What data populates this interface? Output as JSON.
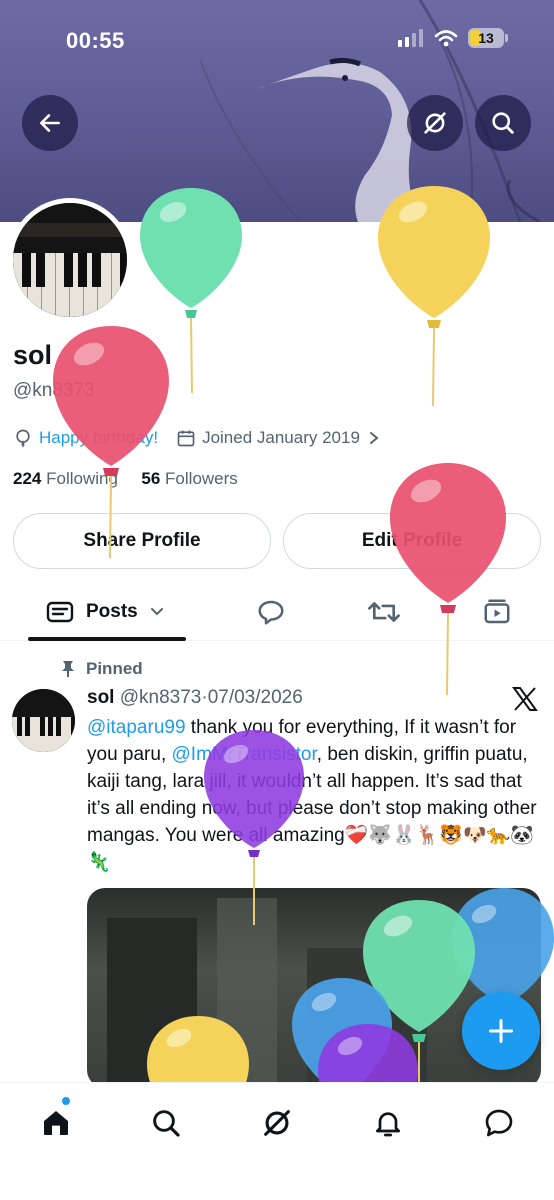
{
  "status_bar": {
    "time": "00:55",
    "battery": "13"
  },
  "profile": {
    "name": "sol",
    "handle": "@kn8373",
    "birthday": "Happy birthday!",
    "joined": "Joined January 2019",
    "following_count": "224",
    "following_label": "Following",
    "followers_count": "56",
    "followers_label": "Followers"
  },
  "buttons": {
    "share": "Share Profile",
    "edit": "Edit Profile"
  },
  "tabs": {
    "posts": "Posts"
  },
  "post": {
    "pinned_label": "Pinned",
    "author": "sol",
    "handle": "@kn8373",
    "separator": "·",
    "date": "07/03/2026",
    "mention1": "@itaparu99",
    "text1": " thank you for everything, If it wasn’t for you paru, ",
    "mention2": "@ImMrTransistor",
    "text2": ", ben diskin, griffin puatu, kaiji tang, lara jill, it wouldn’t all happen. It’s sad that it’s all ending now, but please don’t stop making other mangas. You were all amazing❤️‍🩹🐺🐰🦌🐯🐶🐆🐼🦎"
  },
  "colors": {
    "accent": "#1d9bf0",
    "banner": "#5e5c94",
    "balloon_green": "#6fe0b0",
    "balloon_yellow": "#f5d35a",
    "balloon_red": "#e9506f",
    "balloon_purple": "#8e3be0",
    "balloon_blue": "#4aa3ea"
  },
  "icons": {
    "back": "arrow-left-icon",
    "grok": "grok-icon",
    "search": "search-icon",
    "fab": "plus-icon",
    "nav": [
      "home-icon",
      "search-icon",
      "grok-icon",
      "bell-icon",
      "messages-icon"
    ]
  }
}
